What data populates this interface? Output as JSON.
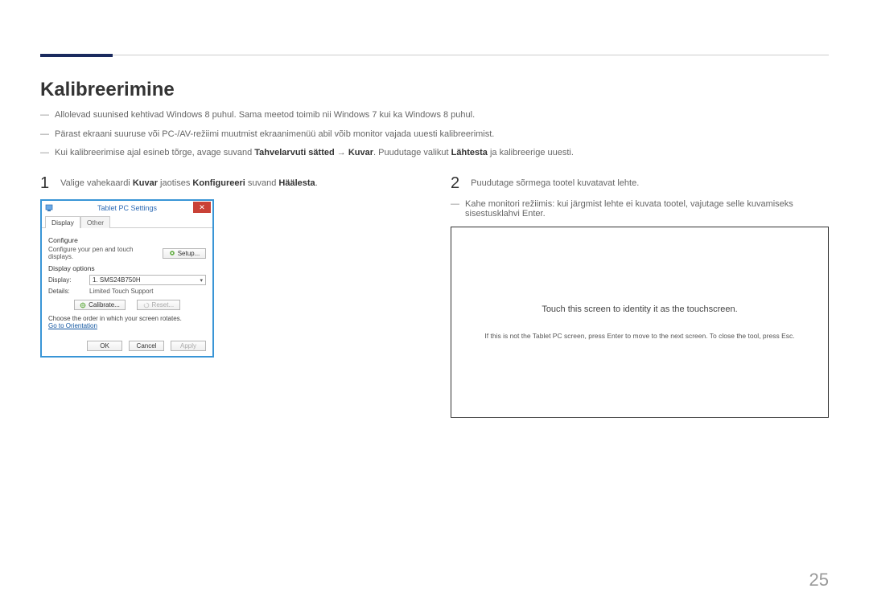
{
  "header": {
    "title": "Kalibreerimine"
  },
  "bullets": {
    "b1": "Allolevad suunised kehtivad Windows 8 puhul. Sama meetod toimib nii Windows 7 kui ka Windows 8 puhul.",
    "b2": "Pärast ekraani suuruse või PC-/AV-režiimi muutmist ekraanimenüü abil võib monitor vajada uuesti kalibreerimist.",
    "b3_pre": "Kui kalibreerimise ajal esineb tõrge, avage suvand ",
    "b3_s1": "Tahvelarvuti sätted",
    "b3_arrow": " → ",
    "b3_s2": "Kuvar",
    "b3_mid": ". Puudutage valikut ",
    "b3_s3": "Lähtesta",
    "b3_post": " ja kalibreerige uuesti."
  },
  "step1": {
    "num": "1",
    "pre": "Valige vahekaardi ",
    "w1": "Kuvar",
    "mid1": " jaotises ",
    "w2": "Konfigureeri",
    "mid2": " suvand ",
    "w3": "Häälesta",
    "post": "."
  },
  "step2": {
    "num": "2",
    "text": "Puudutage sõrmega tootel kuvatavat lehte.",
    "note": "Kahe monitori režiimis: kui järgmist lehte ei kuvata tootel, vajutage selle kuvamiseks sisestusklahvi Enter."
  },
  "dialog": {
    "title": "Tablet PC Settings",
    "tab_display": "Display",
    "tab_other": "Other",
    "configure": "Configure",
    "configure_text": "Configure your pen and touch displays.",
    "setup_btn": "Setup...",
    "display_options": "Display options",
    "display_label": "Display:",
    "display_value": "1. SMS24B750H",
    "details_label": "Details:",
    "details_value": "Limited Touch Support",
    "calibrate_btn": "Calibrate...",
    "reset_btn": "Reset...",
    "order_text": "Choose the order in which your screen rotates.",
    "orientation_link": "Go to Orientation",
    "ok": "OK",
    "cancel": "Cancel",
    "apply": "Apply"
  },
  "touchpane": {
    "main": "Touch this screen to identity it as the touchscreen.",
    "sub": "If this is not the Tablet PC screen, press Enter to move to the next screen. To close the tool, press Esc."
  },
  "page_number": "25"
}
